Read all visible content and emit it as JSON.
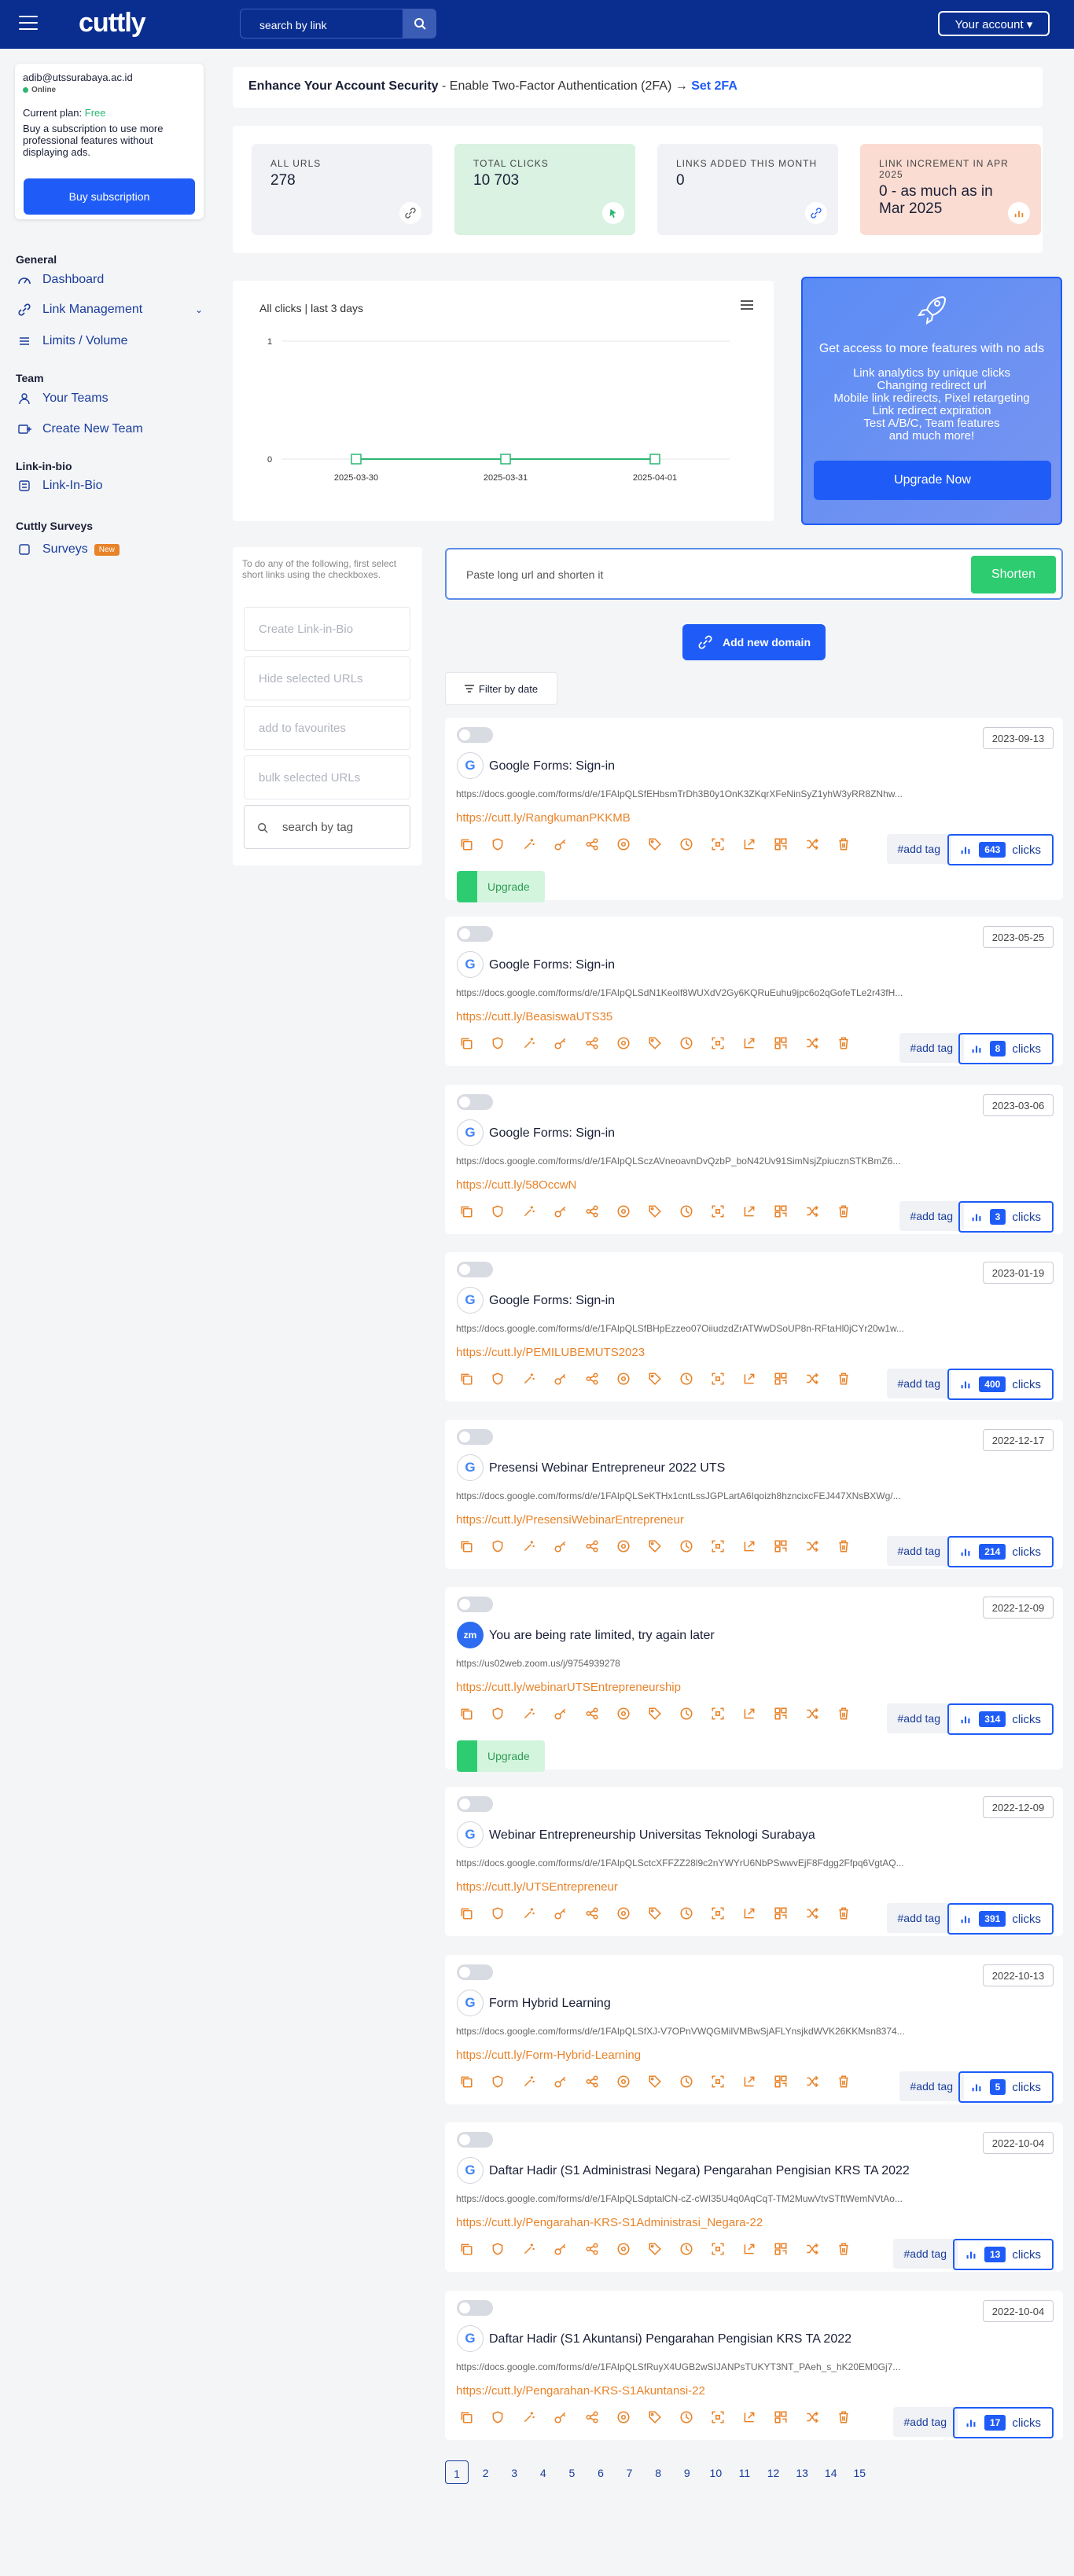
{
  "topbar": {
    "logo": "cuttly",
    "search_placeholder": "search by link",
    "account_label": "Your account"
  },
  "sidebar": {
    "email": "adib@utssurabaya.ac.id",
    "status": "Online",
    "plan_label": "Current plan:",
    "plan_value": "Free",
    "buy_text": "Buy a subscription to use more professional features without displaying ads.",
    "buy_button": "Buy subscription",
    "sections": {
      "general": "General",
      "team": "Team",
      "linkinbio": "Link-in-bio",
      "surveys": "Cuttly Surveys"
    },
    "items": {
      "dashboard": "Dashboard",
      "link_management": "Link Management",
      "limits": "Limits / Volume",
      "your_teams": "Your Teams",
      "create_team": "Create New Team",
      "link_in_bio": "Link-In-Bio",
      "surveys": "Surveys",
      "surveys_badge": "New"
    }
  },
  "banner": {
    "lead": "Enhance Your Account Security",
    "text": " - Enable Two-Factor Authentication (2FA) → ",
    "link": "Set 2FA"
  },
  "stats": [
    {
      "label": "ALL URLS",
      "value": "278",
      "bg": "#f1f2f5",
      "icon": "link-icon"
    },
    {
      "label": "TOTAL CLICKS",
      "value": "10 703",
      "bg": "#d9f2e2",
      "icon": "cursor-icon"
    },
    {
      "label": "LINKS ADDED THIS MONTH",
      "value": "0",
      "bg": "#f1f2f5",
      "icon": "link-add-icon"
    },
    {
      "label": "LINK INCREMENT IN APR 2025",
      "value": "0 - as much as in Mar 2025",
      "bg": "#fbdcd2",
      "icon": "bar-chart-icon"
    }
  ],
  "chart_data": {
    "type": "line",
    "title": "All clicks | last 3 days",
    "categories": [
      "2025-03-30",
      "2025-03-31",
      "2025-04-01"
    ],
    "values": [
      0,
      0,
      0
    ],
    "ylim": [
      0,
      1
    ],
    "yticks": [
      "1",
      "0"
    ],
    "grid": true,
    "color": "#2bb673"
  },
  "promo": {
    "title": "Get access to more features with no ads",
    "features": "Link analytics by unique clicks\nChanging redirect url\nMobile link redirects, Pixel retargeting\nLink redirect expiration\nTest A/B/C, Team features\nand much more!",
    "button": "Upgrade Now"
  },
  "bulk": {
    "hint": "To do any of the following, first select short links using the checkboxes.",
    "create": "Create Link-in-Bio",
    "hide": "Hide selected URLs",
    "fav": "add to favourites",
    "bulk": "bulk selected URLs",
    "tag_search": "search by tag"
  },
  "shorten": {
    "placeholder": "Paste long url and shorten it",
    "button": "Shorten"
  },
  "add_domain": "Add new domain",
  "filter": "Filter by date",
  "add_tag": "#add tag",
  "clicks_word": "clicks",
  "upgrade_word": "Upgrade",
  "links": [
    {
      "date": "2023-09-13",
      "title": "Google Forms: Sign-in",
      "url": "https://docs.google.com/forms/d/e/1FAIpQLSfEHbsmTrDh3B0y1OnK3ZKqrXFeNinSyZ1yhW3yRR8ZNhw...",
      "short": "https://cutt.ly/RangkumanPKKMB",
      "clicks": "643",
      "icon": "G",
      "upgrade": true
    },
    {
      "date": "2023-05-25",
      "title": "Google Forms: Sign-in",
      "url": "https://docs.google.com/forms/d/e/1FAIpQLSdN1Keolf8WUXdV2Gy6KQRuEuhu9jpc6o2qGofeTLe2r43fH...",
      "short": "https://cutt.ly/BeasiswaUTS35",
      "clicks": "8",
      "icon": "G",
      "upgrade": false
    },
    {
      "date": "2023-03-06",
      "title": "Google Forms: Sign-in",
      "url": "https://docs.google.com/forms/d/e/1FAIpQLSczAVneoavnDvQzbP_boN42Uv91SimNsjZpiucznSTKBmZ6...",
      "short": "https://cutt.ly/58OccwN",
      "clicks": "3",
      "icon": "G",
      "upgrade": false
    },
    {
      "date": "2023-01-19",
      "title": "Google Forms: Sign-in",
      "url": "https://docs.google.com/forms/d/e/1FAIpQLSfBHpEzzeo07OiiudzdZrATWwDSoUP8n-RFtaHl0jCYr20w1w...",
      "short": "https://cutt.ly/PEMILUBEMUTS2023",
      "clicks": "400",
      "icon": "G",
      "upgrade": false
    },
    {
      "date": "2022-12-17",
      "title": "Presensi Webinar Entrepreneur 2022 UTS",
      "url": "https://docs.google.com/forms/d/e/1FAIpQLSeKTHx1cntLssJGPLartA6Iqoizh8hzncixcFEJ447XNsBXWg/...",
      "short": "https://cutt.ly/PresensiWebinarEntrepreneur",
      "clicks": "214",
      "icon": "G",
      "upgrade": false
    },
    {
      "date": "2022-12-09",
      "title": "You are being rate limited, try again later",
      "url": "https://us02web.zoom.us/j/9754939278",
      "short": "https://cutt.ly/webinarUTSEntrepreneurship",
      "clicks": "314",
      "icon": "zm",
      "upgrade": true
    },
    {
      "date": "2022-12-09",
      "title": "Webinar Entrepreneurship Universitas Teknologi Surabaya",
      "url": "https://docs.google.com/forms/d/e/1FAIpQLSctcXFFZZ28l9c2nYWYrU6NbPSwwvEjF8Fdgg2Ffpq6VgtAQ...",
      "short": "https://cutt.ly/UTSEntrepreneur",
      "clicks": "391",
      "icon": "G",
      "upgrade": false
    },
    {
      "date": "2022-10-13",
      "title": "Form Hybrid Learning",
      "url": "https://docs.google.com/forms/d/e/1FAIpQLSfXJ-V7OPnVWQGMilVMBwSjAFLYnsjkdWVK26KKMsn8374...",
      "short": "https://cutt.ly/Form-Hybrid-Learning",
      "clicks": "5",
      "icon": "G",
      "upgrade": false
    },
    {
      "date": "2022-10-04",
      "title": "Daftar Hadir (S1 Administrasi Negara) Pengarahan Pengisian KRS TA 2022",
      "url": "https://docs.google.com/forms/d/e/1FAIpQLSdptalCN-cZ-cWI35U4q0AqCqT-TM2MuwVtvSTftWemNVtAo...",
      "short": "https://cutt.ly/Pengarahan-KRS-S1Administrasi_Negara-22",
      "clicks": "13",
      "icon": "G",
      "upgrade": false
    },
    {
      "date": "2022-10-04",
      "title": "Daftar Hadir (S1 Akuntansi) Pengarahan Pengisian KRS TA 2022",
      "url": "https://docs.google.com/forms/d/e/1FAIpQLSfRuyX4UGB2wSIJANPsTUKYT3NT_PAeh_s_hK20EM0Gj7...",
      "short": "https://cutt.ly/Pengarahan-KRS-S1Akuntansi-22",
      "clicks": "17",
      "icon": "G",
      "upgrade": false
    }
  ],
  "pages": [
    "1",
    "2",
    "3",
    "4",
    "5",
    "6",
    "7",
    "8",
    "9",
    "10",
    "11",
    "12",
    "13",
    "14",
    "15"
  ],
  "colors": {
    "brand": "#0a2e8f",
    "accent": "#1f5cf7",
    "short_link": "#e8832a",
    "green": "#2ecc71"
  }
}
